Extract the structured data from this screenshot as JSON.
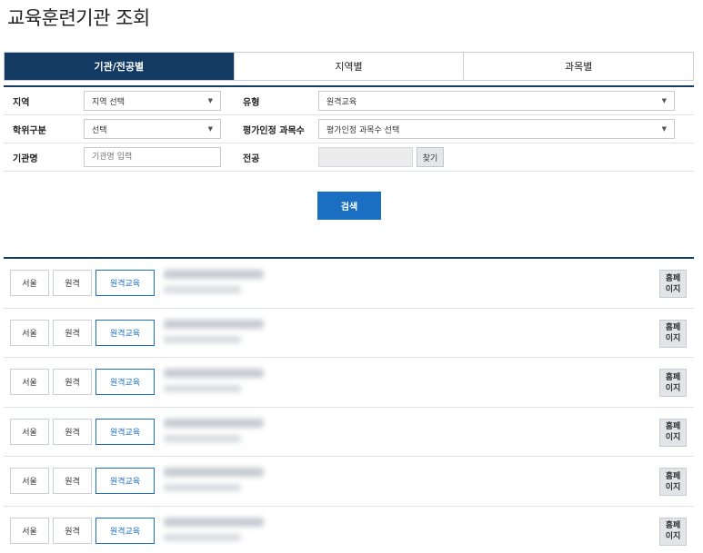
{
  "page": {
    "title": "교육훈련기관 조회"
  },
  "tabs": [
    {
      "label": "기관/전공별",
      "active": true
    },
    {
      "label": "지역별",
      "active": false
    },
    {
      "label": "과목별",
      "active": false
    }
  ],
  "filters": {
    "region": {
      "label": "지역",
      "value": "지역 선택"
    },
    "type": {
      "label": "유형",
      "value": "원격교육"
    },
    "degree": {
      "label": "학위구분",
      "value": "선택"
    },
    "course_count": {
      "label": "평가인정 과목수",
      "value": "평가인정 과목수 선택"
    },
    "institution": {
      "label": "기관명",
      "placeholder": "기관명 입력"
    },
    "major": {
      "label": "전공",
      "value": "",
      "find_label": "찾기"
    },
    "search_label": "검색"
  },
  "results": [
    {
      "region": "서울",
      "mode": "원격",
      "category": "원격교육",
      "homepage_label": "홈페\n이지"
    },
    {
      "region": "서울",
      "mode": "원격",
      "category": "원격교육",
      "homepage_label": "홈페\n이지"
    },
    {
      "region": "서울",
      "mode": "원격",
      "category": "원격교육",
      "homepage_label": "홈페\n이지"
    },
    {
      "region": "서울",
      "mode": "원격",
      "category": "원격교육",
      "homepage_label": "홈페\n이지"
    },
    {
      "region": "서울",
      "mode": "원격",
      "category": "원격교육",
      "homepage_label": "홈페\n이지"
    },
    {
      "region": "서울",
      "mode": "원격",
      "category": "원격교육",
      "homepage_label": "홈페\n이지"
    }
  ],
  "colors": {
    "primary_navy": "#123a63",
    "accent_blue": "#1b6fc2"
  }
}
